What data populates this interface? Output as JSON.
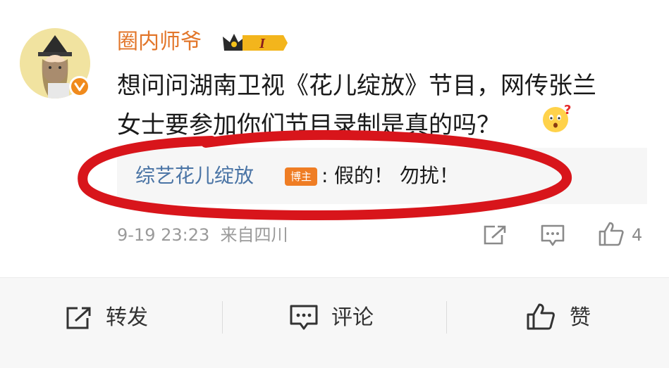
{
  "post": {
    "username": "圈内师爷",
    "member_badge": "I",
    "content": "想问问湖南卫视《花儿绽放》节目，网传张兰女士要参加你们节目录制是真的吗？",
    "emoji": "question-face-emoji"
  },
  "reply": {
    "author": "综艺花儿绽放",
    "author_tag": "博主",
    "separator": ":",
    "text": "假的！ 勿扰！"
  },
  "meta": {
    "time": "9-19 23:23",
    "source": "来自四川",
    "like_count": "4"
  },
  "bottom_bar": {
    "repost": "转发",
    "comment": "评论",
    "like": "赞"
  },
  "colors": {
    "username": "#e2762a",
    "reply_author": "#4a74a5",
    "host_tag": "#ef7d24",
    "annotation": "#d8151b"
  }
}
